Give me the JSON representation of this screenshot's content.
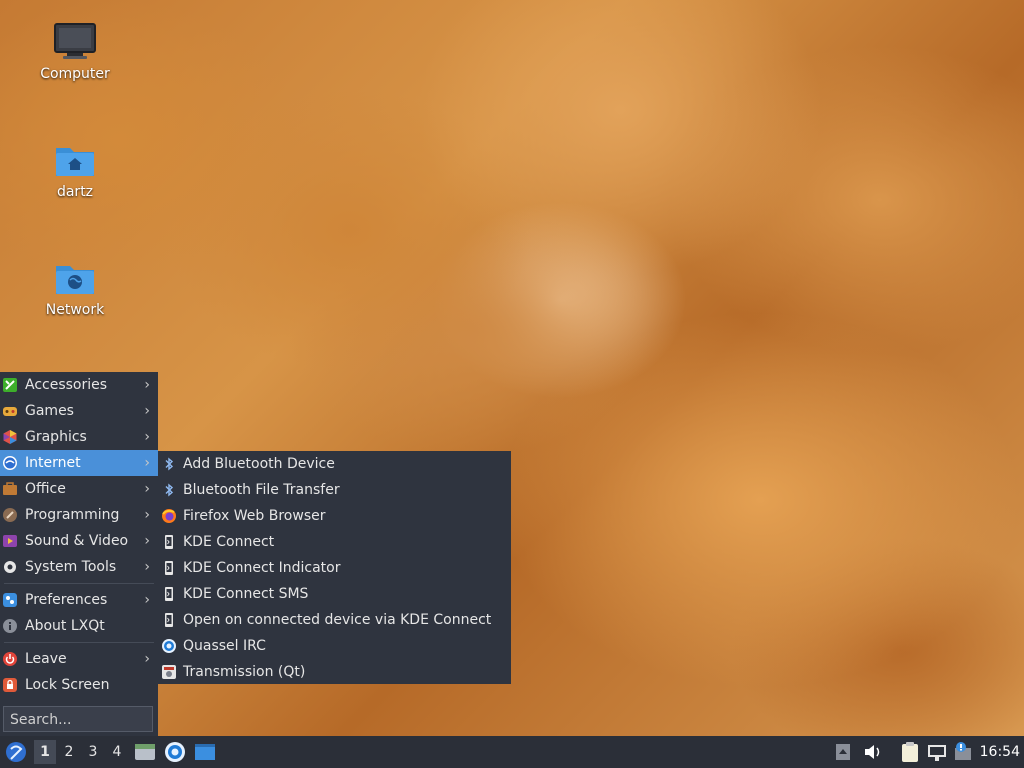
{
  "desktop": {
    "icons": [
      {
        "label": "Computer"
      },
      {
        "label": "dartz"
      },
      {
        "label": "Network"
      }
    ]
  },
  "menu": {
    "items": [
      {
        "label": "Accessories",
        "icon": "accessories-icon",
        "color": "#3dae2b",
        "has_submenu": true
      },
      {
        "label": "Games",
        "icon": "games-icon",
        "color": "#e7a93b",
        "has_submenu": true
      },
      {
        "label": "Graphics",
        "icon": "graphics-icon",
        "color": "#e0534a",
        "has_submenu": true
      },
      {
        "label": "Internet",
        "icon": "internet-icon",
        "color": "#2f6fd1",
        "has_submenu": true
      },
      {
        "label": "Office",
        "icon": "office-icon",
        "color": "#c07a35",
        "has_submenu": true
      },
      {
        "label": "Programming",
        "icon": "programming-icon",
        "color": "#8a6b52",
        "has_submenu": true
      },
      {
        "label": "Sound & Video",
        "icon": "sound-video-icon",
        "color": "#d64b8a",
        "has_submenu": true
      },
      {
        "label": "System Tools",
        "icon": "system-tools-icon",
        "color": "#7a7f8a",
        "has_submenu": true
      },
      {
        "label": "Preferences",
        "icon": "preferences-icon",
        "color": "#3b8fe0",
        "has_submenu": true
      },
      {
        "label": "About LXQt",
        "icon": "info-icon",
        "color": "#8a8f99",
        "has_submenu": false
      },
      {
        "label": "Leave",
        "icon": "power-icon",
        "color": "#e0443a",
        "has_submenu": true
      },
      {
        "label": "Lock Screen",
        "icon": "lock-icon",
        "color": "#e05a3a",
        "has_submenu": false
      }
    ],
    "active": "Internet",
    "search_placeholder": "Search..."
  },
  "submenu": {
    "items": [
      {
        "label": "Add Bluetooth Device",
        "icon": "bluetooth-icon"
      },
      {
        "label": "Bluetooth File Transfer",
        "icon": "bluetooth-icon"
      },
      {
        "label": "Firefox Web Browser",
        "icon": "firefox-icon"
      },
      {
        "label": "KDE Connect",
        "icon": "kde-connect-icon"
      },
      {
        "label": "KDE Connect Indicator",
        "icon": "kde-connect-icon"
      },
      {
        "label": "KDE Connect SMS",
        "icon": "kde-connect-icon"
      },
      {
        "label": "Open on connected device via KDE Connect",
        "icon": "kde-connect-icon"
      },
      {
        "label": "Quassel IRC",
        "icon": "quassel-icon"
      },
      {
        "label": "Transmission (Qt)",
        "icon": "transmission-icon"
      }
    ]
  },
  "taskbar": {
    "workspaces": [
      "1",
      "2",
      "3",
      "4"
    ],
    "active_workspace": "1",
    "clock": "16:54"
  },
  "colors": {
    "panel": "#2f343f",
    "highlight": "#4a90d9",
    "taskbar": "#2b2f38"
  }
}
